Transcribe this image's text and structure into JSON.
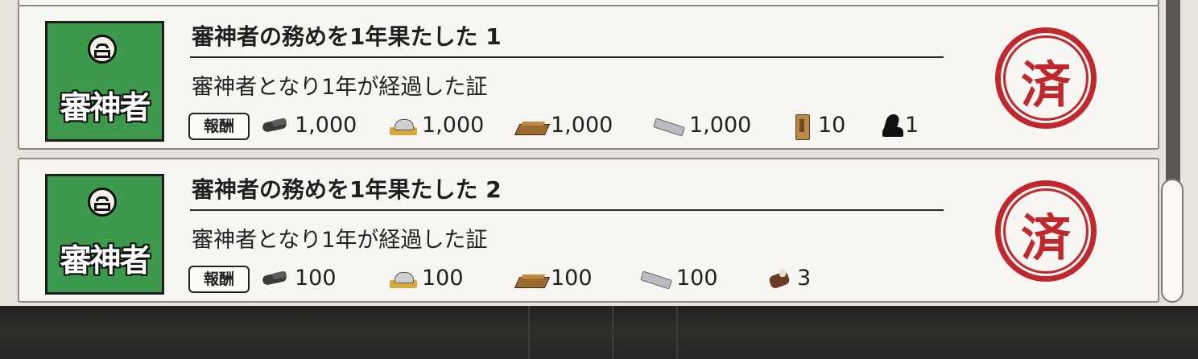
{
  "achievements": [
    {
      "badge_label": "審神者",
      "title": "審神者の務めを1年果たした 1",
      "description": "審神者となり1年が経過した証",
      "reward_label": "報酬",
      "rewards": [
        {
          "icon": "charcoal-icon",
          "value": "1,000"
        },
        {
          "icon": "tamahagane-icon",
          "value": "1,000"
        },
        {
          "icon": "coolant-icon",
          "value": "1,000"
        },
        {
          "icon": "whetstone-icon",
          "value": "1,000"
        },
        {
          "icon": "koban-tag-icon",
          "value": "10"
        },
        {
          "icon": "horse-icon",
          "value": "1"
        }
      ],
      "status_stamp": "済"
    },
    {
      "badge_label": "審神者",
      "title": "審神者の務めを1年果たした 2",
      "description": "審神者となり1年が経過した証",
      "reward_label": "報酬",
      "rewards": [
        {
          "icon": "charcoal-icon",
          "value": "100"
        },
        {
          "icon": "tamahagane-icon",
          "value": "100"
        },
        {
          "icon": "coolant-icon",
          "value": "100"
        },
        {
          "icon": "whetstone-icon",
          "value": "100"
        },
        {
          "icon": "equipment-pack-icon",
          "value": "3"
        }
      ],
      "status_stamp": "済"
    }
  ],
  "colors": {
    "badge_green": "#3d9a4c",
    "stamp_red": "#c1282e",
    "card_bg": "#f7f6f3"
  }
}
